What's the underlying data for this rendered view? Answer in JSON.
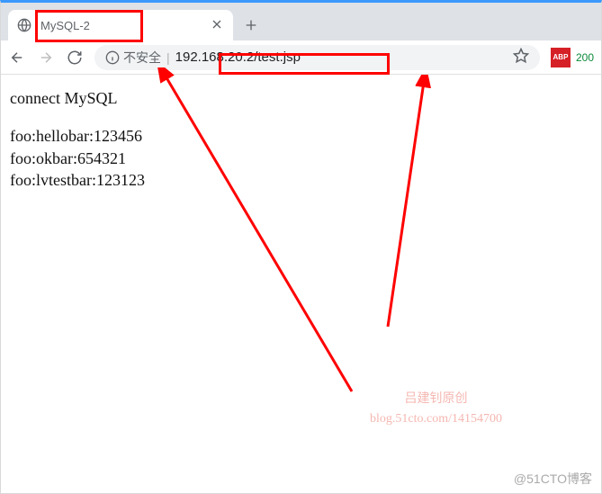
{
  "tab": {
    "title": "MySQL-2"
  },
  "toolbar": {
    "securityText": "不安全",
    "url": "192.168.20.2/test.jsp",
    "abpLabel": "ABP",
    "abpCount": "200"
  },
  "page": {
    "heading": "connect MySQL",
    "rows": [
      "foo:hellobar:123456",
      "foo:okbar:654321",
      "foo:lvtestbar:123123"
    ]
  },
  "watermark": {
    "line1": "吕建钊原创",
    "line2": "blog.51cto.com/14154700",
    "footer": "@51CTO博客"
  }
}
